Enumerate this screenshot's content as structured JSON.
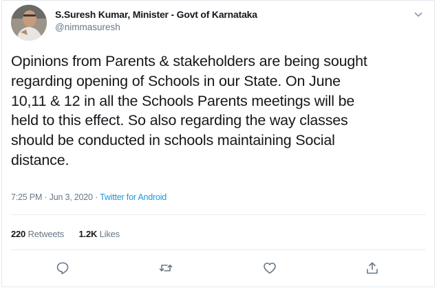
{
  "author": {
    "name": "S.Suresh Kumar, Minister - Govt of Karnataka",
    "handle": "@nimmasuresh"
  },
  "tweet": {
    "text": "Opinions from Parents & stakeholders are being sought\nregarding opening of Schools in our State. On June\n10,11 & 12 in all the Schools Parents meetings will be\nheld to this effect. So also regarding the way classes\nshould be conducted in schools maintaining Social\ndistance.",
    "time": "7:25 PM · Jun 3, 2020",
    "separator": "·",
    "source": "Twitter for Android"
  },
  "stats": {
    "retweets_count": "220",
    "retweets_label": "Retweets",
    "likes_count": "1.2K",
    "likes_label": "Likes"
  },
  "icons": {
    "more": "chevron-down-icon",
    "reply": "reply-icon",
    "retweet": "retweet-icon",
    "like": "heart-icon",
    "share": "share-icon"
  },
  "colors": {
    "link": "#1b95e0",
    "muted": "#657786",
    "text": "#14171a"
  }
}
